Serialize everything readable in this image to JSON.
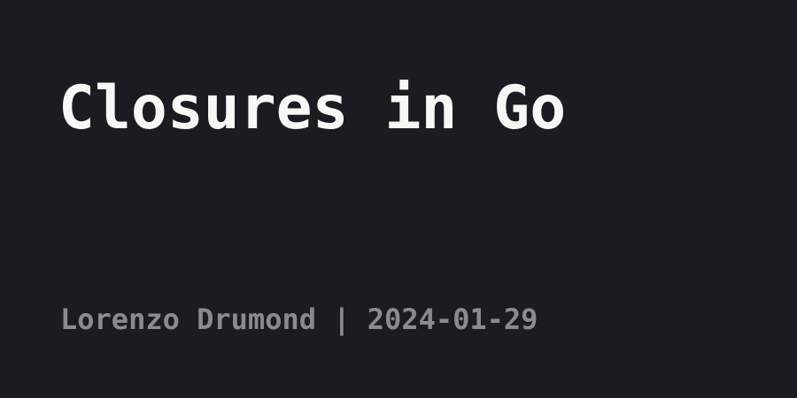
{
  "post": {
    "title": "Closures in Go",
    "meta": "Lorenzo Drumond | 2024-01-29"
  },
  "colors": {
    "background": "#1b1c22",
    "title": "#f7f7f5",
    "meta": "#8b8b8f"
  }
}
